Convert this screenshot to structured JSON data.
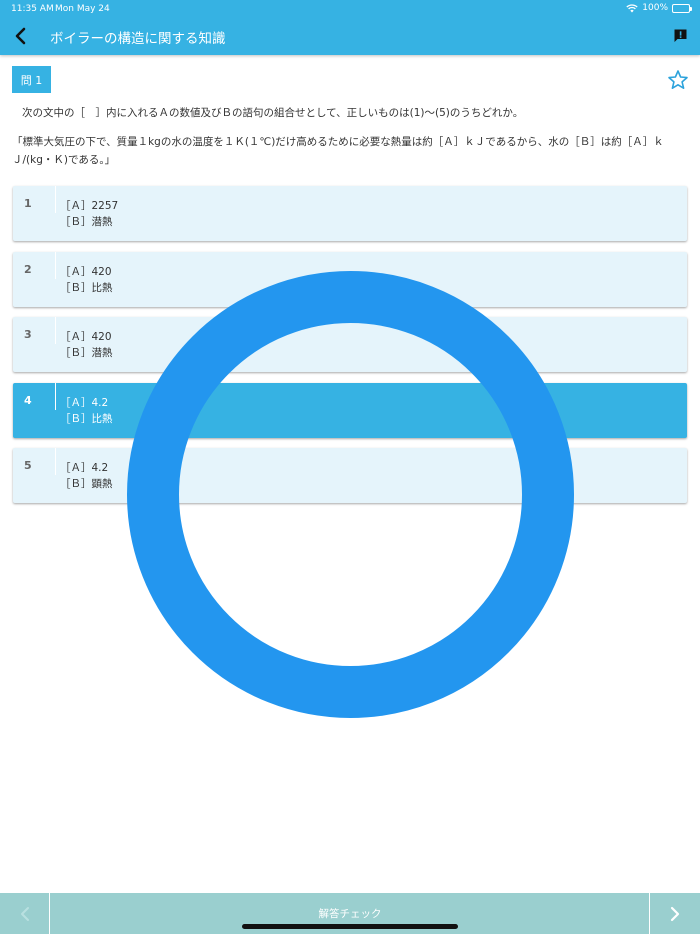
{
  "status_bar": {
    "time": "11:35 AM",
    "date": "Mon May 24",
    "battery": "100%"
  },
  "nav": {
    "title": "ボイラーの構造に関する知識",
    "back_icon": "chevron-left-icon",
    "report_icon": "report-icon"
  },
  "question": {
    "badge": "問 1",
    "text": "次の文中の［　］内に入れるＡの数値及びＢの語句の組合せとして、正しいものは(1)〜(5)のうちどれか。",
    "quote": "「標準大気圧の下で、質量１kgの水の温度を１Ｋ(１℃)だけ高めるために必要な熱量は約［Ａ］ｋＪであるから、水の［Ｂ］は約［Ａ］ｋＪ/(kg・Ｋ)である。」"
  },
  "choices": [
    {
      "num": "1",
      "a": "［Ａ］2257",
      "b": "［Ｂ］潜熱"
    },
    {
      "num": "2",
      "a": "［Ａ］420",
      "b": "［Ｂ］比熱"
    },
    {
      "num": "3",
      "a": "［Ａ］420",
      "b": "［Ｂ］潜熱"
    },
    {
      "num": "4",
      "a": "［Ａ］4.2",
      "b": "［Ｂ］比熱"
    },
    {
      "num": "5",
      "a": "［Ａ］4.2",
      "b": "［Ｂ］顕熱"
    }
  ],
  "selected_choice": 4,
  "result_mark": "correct-circle-icon",
  "bottom": {
    "check_label": "解答チェック",
    "prev_icon": "chevron-left-icon",
    "next_icon": "chevron-right-icon"
  },
  "colors": {
    "accent": "#36b2e3",
    "choice_bg": "#e5f4fb",
    "ring": "#2396ef",
    "bottom_bar": "#9acfcf"
  }
}
